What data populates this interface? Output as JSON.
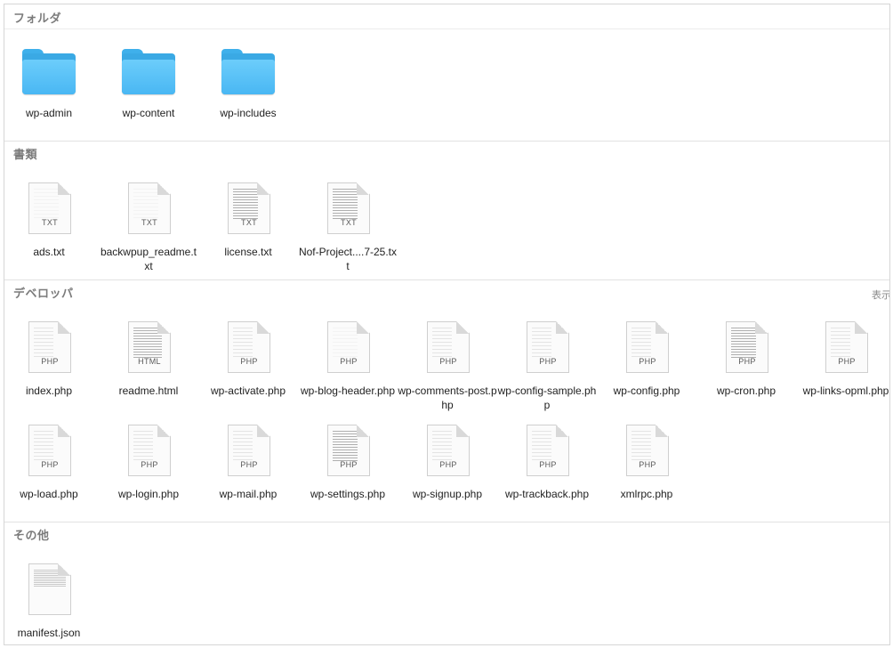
{
  "sections": {
    "folders": {
      "title": "フォルダ",
      "items": [
        {
          "label": "wp-admin"
        },
        {
          "label": "wp-content"
        },
        {
          "label": "wp-includes"
        }
      ]
    },
    "documents": {
      "title": "書類",
      "items": [
        {
          "label": "ads.txt",
          "ext": "TXT"
        },
        {
          "label": "backwpup_readme.txt",
          "ext": "TXT"
        },
        {
          "label": "license.txt",
          "ext": "TXT"
        },
        {
          "label": "Nof-Project....7-25.txt",
          "ext": "TXT"
        }
      ]
    },
    "developer": {
      "title": "デベロッパ",
      "show_more": "表示",
      "items": [
        {
          "label": "index.php",
          "ext": "PHP"
        },
        {
          "label": "readme.html",
          "ext": "HTML"
        },
        {
          "label": "wp-activate.php",
          "ext": "PHP"
        },
        {
          "label": "wp-blog-header.php",
          "ext": "PHP"
        },
        {
          "label": "wp-comments-post.php",
          "ext": "PHP"
        },
        {
          "label": "wp-config-sample.php",
          "ext": "PHP"
        },
        {
          "label": "wp-config.php",
          "ext": "PHP"
        },
        {
          "label": "wp-cron.php",
          "ext": "PHP"
        },
        {
          "label": "wp-links-opml.php",
          "ext": "PHP"
        },
        {
          "label": "wp-load.php",
          "ext": "PHP"
        },
        {
          "label": "wp-login.php",
          "ext": "PHP"
        },
        {
          "label": "wp-mail.php",
          "ext": "PHP"
        },
        {
          "label": "wp-settings.php",
          "ext": "PHP"
        },
        {
          "label": "wp-signup.php",
          "ext": "PHP"
        },
        {
          "label": "wp-trackback.php",
          "ext": "PHP"
        },
        {
          "label": "xmlrpc.php",
          "ext": "PHP"
        }
      ]
    },
    "other": {
      "title": "その他",
      "items": [
        {
          "label": "manifest.json",
          "ext": ""
        }
      ]
    }
  }
}
